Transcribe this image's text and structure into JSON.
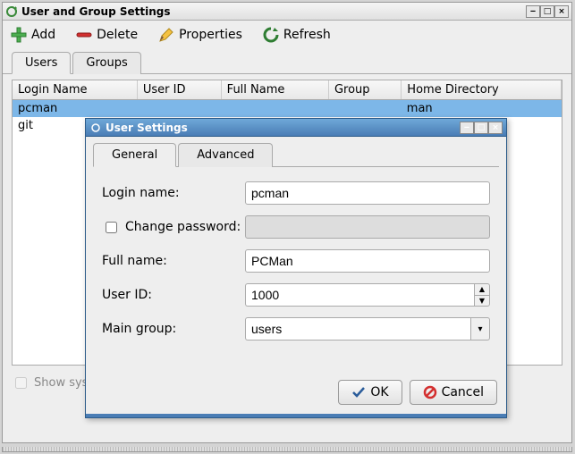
{
  "window": {
    "title": "User and Group Settings"
  },
  "toolbar": {
    "add": "Add",
    "delete": "Delete",
    "properties": "Properties",
    "refresh": "Refresh"
  },
  "tabs": {
    "users": "Users",
    "groups": "Groups"
  },
  "columns": {
    "login": "Login Name",
    "uid": "User ID",
    "full": "Full Name",
    "group": "Group",
    "home": "Home Directory"
  },
  "rows": [
    {
      "login": "pcman",
      "uid": "",
      "full": "",
      "group": "",
      "home": "man"
    },
    {
      "login": "git",
      "uid": "",
      "full": "",
      "group": "",
      "home": ""
    }
  ],
  "footer": {
    "show_system": "Show system users (for advanced users only)"
  },
  "dialog": {
    "title": "User Settings",
    "tabs": {
      "general": "General",
      "advanced": "Advanced"
    },
    "labels": {
      "login": "Login name:",
      "change_pw": "Change password:",
      "full": "Full name:",
      "uid": "User ID:",
      "main_group": "Main group:"
    },
    "values": {
      "login": "pcman",
      "password": "",
      "full": "PCMan",
      "uid": "1000",
      "main_group": "users"
    },
    "buttons": {
      "ok": "OK",
      "cancel": "Cancel"
    }
  },
  "colors": {
    "accent": "#4a7db5",
    "selection": "#7db7e8"
  }
}
